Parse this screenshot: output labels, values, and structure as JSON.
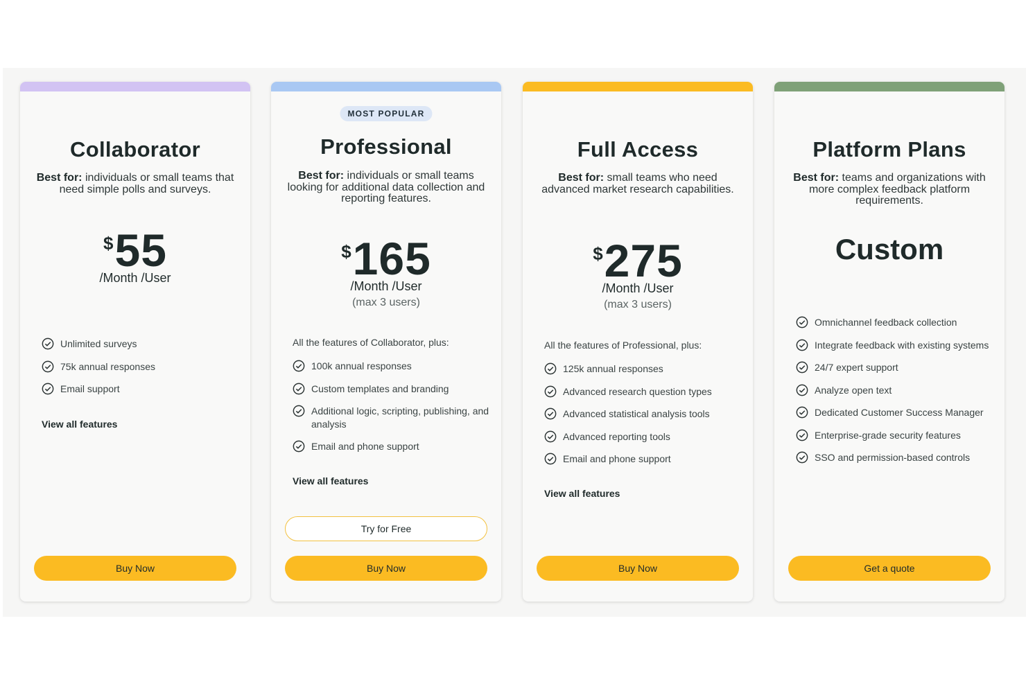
{
  "colors": {
    "collaborator_bar": "#d2c3f3",
    "professional_bar": "#a9c8f3",
    "full_access_bar": "#fbbb22",
    "platform_bar": "#7fa178",
    "button": "#fbbb22"
  },
  "plans": [
    {
      "title": "Collaborator",
      "best_for_label": "Best for:",
      "best_for": " individuals or small teams that need simple polls and surveys.",
      "currency": "$",
      "price": "55",
      "per": "/Month /User",
      "features": [
        "Unlimited surveys",
        "75k annual responses",
        "Email support"
      ],
      "view_all": "View all features",
      "button": "Buy Now"
    },
    {
      "badge": "MOST POPULAR",
      "title": "Professional",
      "best_for_label": "Best for:",
      "best_for": " individuals or small teams looking for additional data collection and reporting features.",
      "currency": "$",
      "price": "165",
      "per": "/Month /User",
      "max": "(max 3 users)",
      "intro": "All the features of Collaborator, plus:",
      "features": [
        "100k annual responses",
        "Custom templates and branding",
        "Additional logic, scripting, publishing, and analysis",
        "Email and phone support"
      ],
      "view_all": "View all features",
      "secondary_button": "Try for Free",
      "button": "Buy Now"
    },
    {
      "title": "Full Access",
      "best_for_label": "Best for:",
      "best_for": " small teams who need advanced market research capabilities.",
      "currency": "$",
      "price": "275",
      "per": "/Month /User",
      "max": "(max 3 users)",
      "intro": "All the features of Professional, plus:",
      "features": [
        "125k annual responses",
        "Advanced research question types",
        "Advanced statistical analysis tools",
        "Advanced reporting tools",
        "Email and phone support"
      ],
      "view_all": "View all features",
      "button": "Buy Now"
    },
    {
      "title": "Platform Plans",
      "best_for_label": "Best for:",
      "best_for": " teams and organizations with more complex feedback platform requirements.",
      "price": "Custom",
      "features": [
        "Omnichannel feedback collection",
        "Integrate feedback with existing systems",
        "24/7 expert support",
        "Analyze open text",
        "Dedicated Customer Success Manager",
        "Enterprise-grade security features",
        "SSO and permission-based controls"
      ],
      "button": "Get a quote"
    }
  ],
  "icons": {
    "feature_check": "check-circle-icon"
  }
}
